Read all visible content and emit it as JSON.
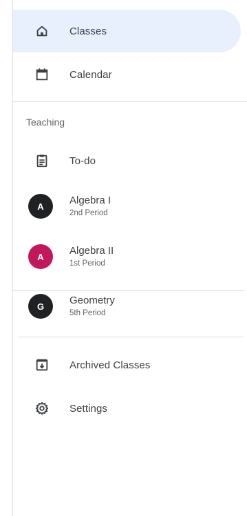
{
  "nav": {
    "classes": {
      "label": "Classes",
      "icon": "home-icon"
    },
    "calendar": {
      "label": "Calendar",
      "icon": "calendar-icon"
    }
  },
  "teaching": {
    "title": "Teaching",
    "todo": {
      "label": "To-do",
      "icon": "clipboard-icon"
    },
    "classes": [
      {
        "initial": "A",
        "name": "Algebra I",
        "period": "2nd Period",
        "color": "#202124"
      },
      {
        "initial": "A",
        "name": "Algebra II",
        "period": "1st Period",
        "color": "#c2185b"
      },
      {
        "initial": "G",
        "name": "Geometry",
        "period": "5th Period",
        "color": "#202124"
      }
    ]
  },
  "footer": {
    "archived": {
      "label": "Archived Classes",
      "icon": "archive-icon"
    },
    "settings": {
      "label": "Settings",
      "icon": "gear-icon"
    }
  },
  "colors": {
    "active_bg": "#e8f0fe",
    "divider": "#dadce0",
    "text": "#3c4043",
    "muted": "#5f6368"
  }
}
